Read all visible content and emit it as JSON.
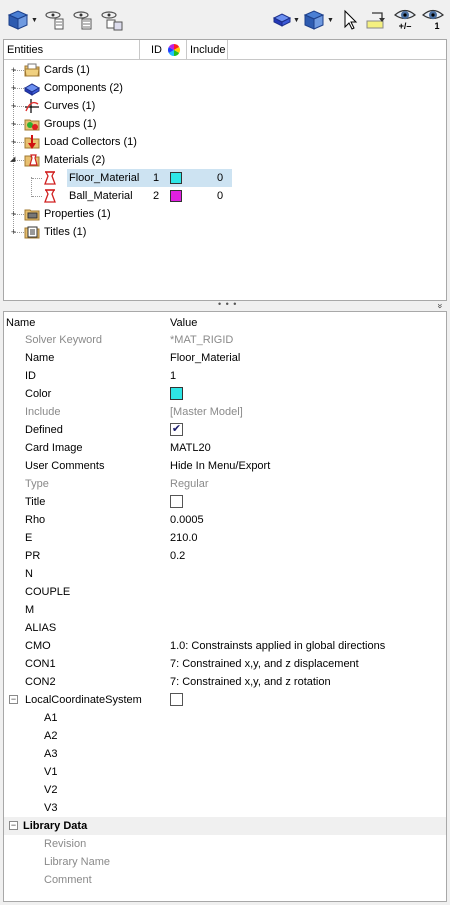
{
  "colors": {
    "floor_material": "#2ee6e6",
    "ball_material": "#e020e0",
    "selection": "#cde3f2"
  },
  "toolbar": {
    "left_icons": [
      "entity-view-icon",
      "column-filter-icon",
      "column-list-icon",
      "entity-state-icon"
    ],
    "right_icons": [
      "display-box-icon",
      "entity-view-right-icon",
      "select-arrow-icon",
      "highlight-icon",
      "show-plus-minus-icon",
      "show-one-icon"
    ],
    "plus_minus_label": "+/–",
    "one_label": "1"
  },
  "tree": {
    "header": {
      "entities": "Entities",
      "id": "ID",
      "include": "Include"
    },
    "items": [
      {
        "label": "Cards (1)",
        "icon": "cards-icon"
      },
      {
        "label": "Components (2)",
        "icon": "components-icon"
      },
      {
        "label": "Curves (1)",
        "icon": "curves-icon"
      },
      {
        "label": "Groups (1)",
        "icon": "groups-icon"
      },
      {
        "label": "Load Collectors (1)",
        "icon": "load-collectors-icon"
      },
      {
        "label": "Materials (2)",
        "icon": "materials-icon"
      },
      {
        "label": "Properties (1)",
        "icon": "properties-icon"
      },
      {
        "label": "Titles (1)",
        "icon": "titles-icon"
      }
    ],
    "materials": [
      {
        "name": "Floor_Material",
        "id": "1",
        "include": "0"
      },
      {
        "name": "Ball_Material",
        "id": "2",
        "include": "0"
      }
    ],
    "splitter_dots": "• • •",
    "splitter_chevron": "»"
  },
  "props": {
    "header": {
      "name": "Name",
      "value": "Value"
    },
    "rows": [
      {
        "name": "Solver Keyword",
        "value": "*MAT_RIGID"
      },
      {
        "name": "Name",
        "value": "Floor_Material"
      },
      {
        "name": "ID",
        "value": "1"
      },
      {
        "name": "Color",
        "value": ""
      },
      {
        "name": "Include",
        "value": "[Master Model]"
      },
      {
        "name": "Defined",
        "value": ""
      },
      {
        "name": "Card Image",
        "value": "MATL20"
      },
      {
        "name": "User Comments",
        "value": "Hide In Menu/Export"
      },
      {
        "name": "Type",
        "value": "Regular"
      },
      {
        "name": "Title",
        "value": ""
      },
      {
        "name": "Rho",
        "value": "0.0005"
      },
      {
        "name": "E",
        "value": "210.0"
      },
      {
        "name": "PR",
        "value": "0.2"
      },
      {
        "name": "N",
        "value": ""
      },
      {
        "name": "COUPLE",
        "value": ""
      },
      {
        "name": "M",
        "value": ""
      },
      {
        "name": "ALIAS",
        "value": ""
      },
      {
        "name": "CMO",
        "value": "1.0: Constrainsts applied in global directions"
      },
      {
        "name": "CON1",
        "value": "7: Constrained x,y, and z displacement"
      },
      {
        "name": "CON2",
        "value": "7: Constrained x,y, and z rotation"
      },
      {
        "name": "LocalCoordinateSystem",
        "value": ""
      },
      {
        "name": "A1",
        "value": ""
      },
      {
        "name": "A2",
        "value": ""
      },
      {
        "name": "A3",
        "value": ""
      },
      {
        "name": "V1",
        "value": ""
      },
      {
        "name": "V2",
        "value": ""
      },
      {
        "name": "V3",
        "value": ""
      },
      {
        "name": "Library Data",
        "value": ""
      },
      {
        "name": "Revision",
        "value": ""
      },
      {
        "name": "Library Name",
        "value": ""
      },
      {
        "name": "Comment",
        "value": ""
      }
    ],
    "defined_checked": true,
    "title_checked": false,
    "lcs_checked": false,
    "collapse_symbol": "−",
    "check_mark": "✔"
  }
}
